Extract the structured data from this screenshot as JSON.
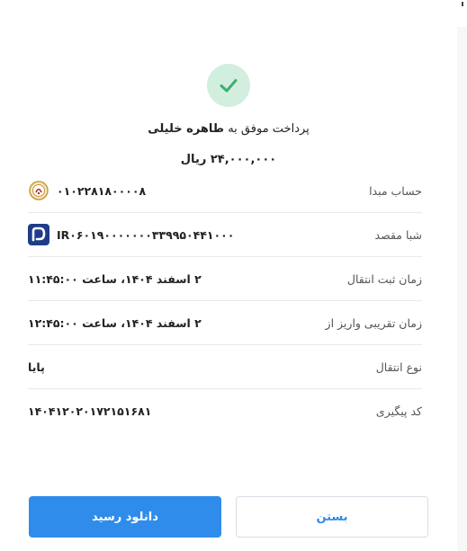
{
  "receipt": {
    "status_prefix": "پرداخت موفق به",
    "recipient_name": "طاهره خلیلی",
    "amount": "۲۴,۰۰۰,۰۰۰ ریال",
    "rows": [
      {
        "label": "حساب مبدا",
        "value": "۰۱۰۲۲۸۱۸۰۰۰۰۸",
        "icon": "bank-melli-logo-icon"
      },
      {
        "label": "شبا مقصد",
        "value": "IR۰۶۰۱۹۰۰۰۰۰۰۰۳۳۹۹۵۰۴۴۱۰۰۰",
        "icon": "bank-saderat-logo-icon"
      },
      {
        "label": "زمان ثبت انتقال",
        "value": "۲ اسفند ۱۴۰۴، ساعت ۱۱:۴۵:۰۰"
      },
      {
        "label": "زمان تقریبی واریز از",
        "value": "۲ اسفند ۱۴۰۴، ساعت ۱۲:۴۵:۰۰"
      },
      {
        "label": "نوع انتقال",
        "value": "پایا"
      },
      {
        "label": "کد پیگیری",
        "value": "۱۴۰۴۱۲۰۲۰۱۷۲۱۵۱۶۸۱"
      }
    ]
  },
  "actions": {
    "close_label": "بستن",
    "download_label": "دانلود رسید"
  },
  "colors": {
    "accent": "#2f8ceb",
    "success_bg": "#d2eedf",
    "success_check": "#3fae70"
  }
}
